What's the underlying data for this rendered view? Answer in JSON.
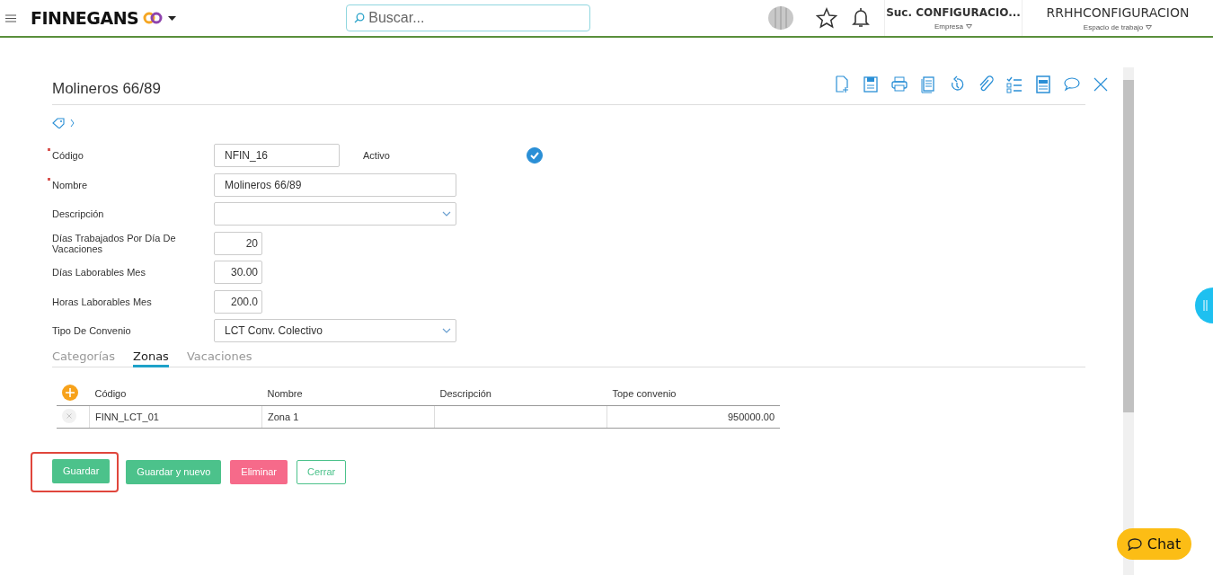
{
  "header": {
    "brand": "FINNEGANS",
    "search": {
      "placeholder": "Buscar..."
    },
    "company": {
      "value": "Suc. CONFIGURACIO...",
      "label": "Empresa"
    },
    "workspace": {
      "value": "RRHHCONFIGURACION",
      "label": "Espacio de trabajo"
    }
  },
  "record": {
    "title": "Molineros 66/89",
    "fields": [
      {
        "label": "Código",
        "required": true,
        "kind": "text",
        "value": "NFIN_16",
        "extra": {
          "label": "Activo",
          "checked": true
        }
      },
      {
        "label": "Nombre",
        "required": true,
        "kind": "wide",
        "value": "Molineros 66/89"
      },
      {
        "label": "Descripción",
        "required": false,
        "kind": "select"
      },
      {
        "label": "Días Trabajados Por Día De Vacaciones",
        "required": false,
        "kind": "number",
        "value": "20"
      },
      {
        "label": "Días Laborables Mes",
        "required": false,
        "kind": "number",
        "value": "30.00"
      },
      {
        "label": "Horas Laborables Mes",
        "required": false,
        "kind": "number",
        "value": "200.0"
      },
      {
        "label": "Tipo De Convenio",
        "required": false,
        "kind": "select",
        "value": "LCT Conv. Colectivo"
      }
    ]
  },
  "tabs": [
    {
      "label": "Categorías",
      "selected": false
    },
    {
      "label": "Zonas",
      "selected": true
    },
    {
      "label": "Vacaciones",
      "selected": false
    }
  ],
  "table": {
    "columns": [
      "Código",
      "Nombre",
      "Descripción",
      "Tope convenio"
    ],
    "rows": [
      {
        "cells": [
          "FINN_LCT_01",
          "Zona 1",
          "",
          "950000.00"
        ]
      }
    ]
  },
  "buttons": [
    {
      "label": "Guardar",
      "kind": "primary",
      "highlighted": true
    },
    {
      "label": "Guardar y nuevo",
      "kind": "primary",
      "highlighted": false
    },
    {
      "label": "Eliminar",
      "kind": "danger",
      "highlighted": false
    },
    {
      "label": "Cerrar",
      "kind": "outline",
      "highlighted": false
    }
  ],
  "chat": {
    "label": "Chat"
  }
}
